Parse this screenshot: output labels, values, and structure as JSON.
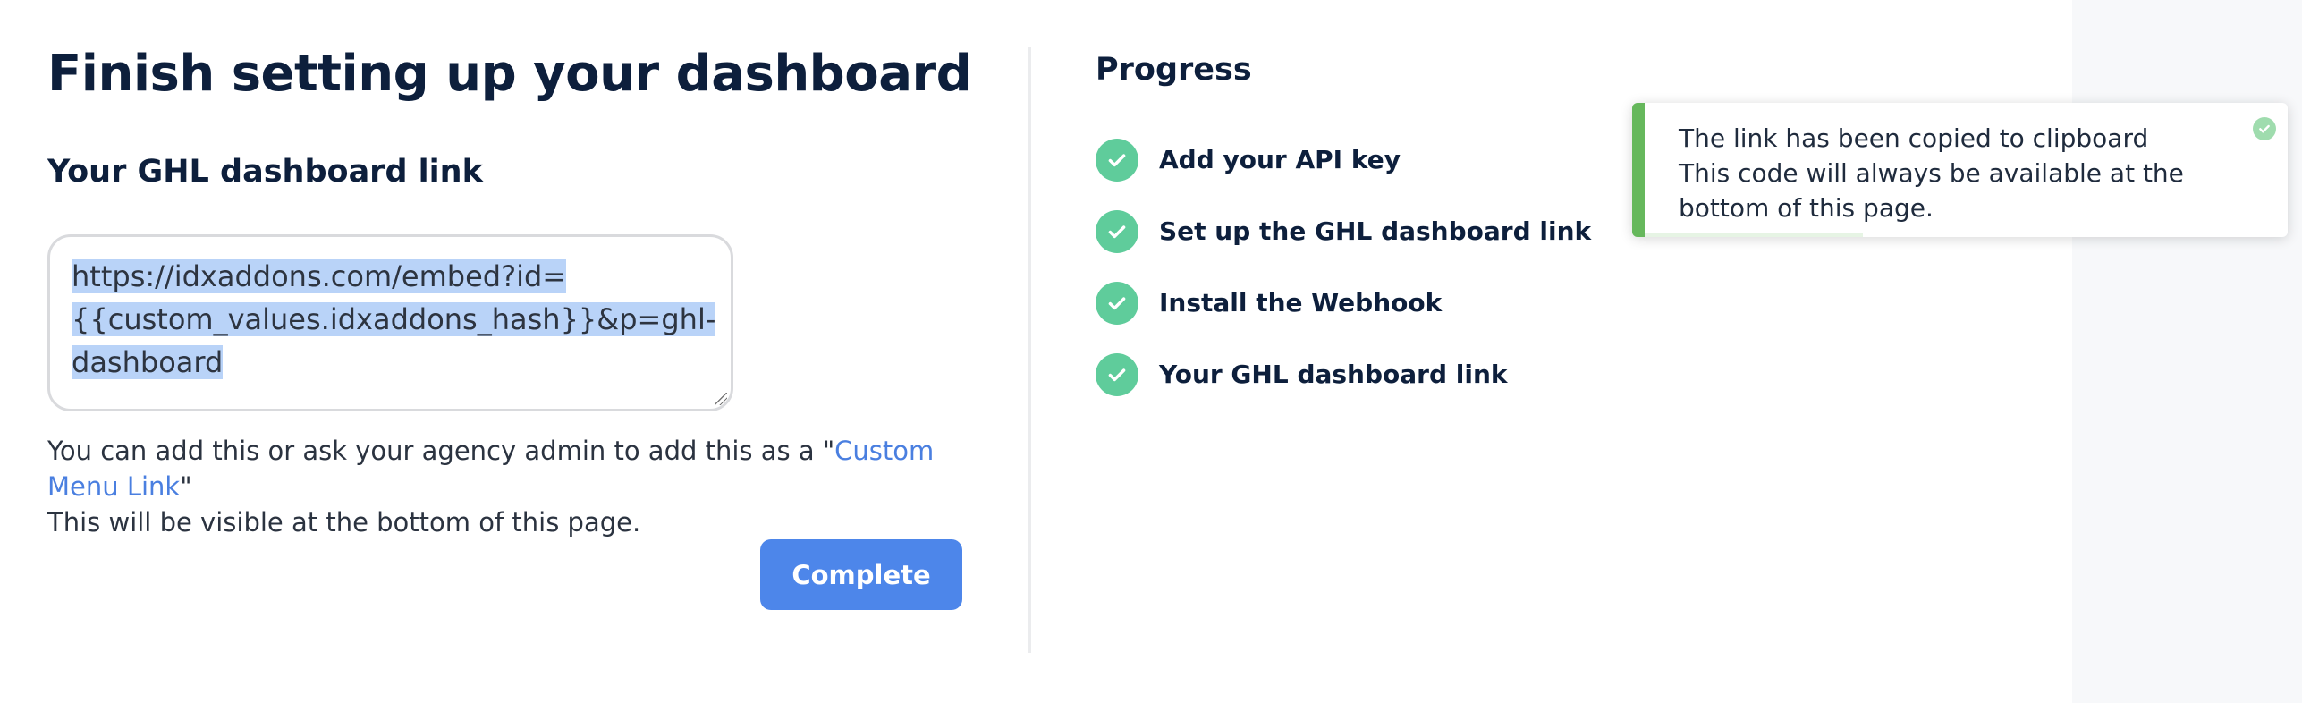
{
  "page": {
    "title": "Finish setting up your dashboard"
  },
  "dashboard_link": {
    "heading": "Your GHL dashboard link",
    "value": "https://idxaddons.com/embed?id={{custom_values.idxaddons_hash}}&p=ghl-dashboard",
    "selected": true
  },
  "help": {
    "text_before": "You can add this or ask your agency admin to add this as a \"",
    "link_text": "Custom Menu Link",
    "text_after": "\"",
    "line2": "This will be visible at the bottom of this page."
  },
  "actions": {
    "complete_label": "Complete"
  },
  "progress": {
    "title": "Progress",
    "items": [
      {
        "label": "Add your API key",
        "done": true
      },
      {
        "label": "Set up the GHL dashboard link",
        "done": true
      },
      {
        "label": "Install the Webhook",
        "done": true
      },
      {
        "label": "Your GHL dashboard link",
        "done": true
      }
    ]
  },
  "toast": {
    "line1": "The link has been copied to clipboard",
    "line2": "This code will always be available at the bottom of this page.",
    "type": "success",
    "progress_remaining": 0.34
  },
  "colors": {
    "accent": "#4d86ea",
    "link": "#4a7fe0",
    "success": "#5fcc9b",
    "toast_bar": "#66b85c",
    "heading": "#0d1f3c",
    "selection": "#b9d3f8"
  }
}
